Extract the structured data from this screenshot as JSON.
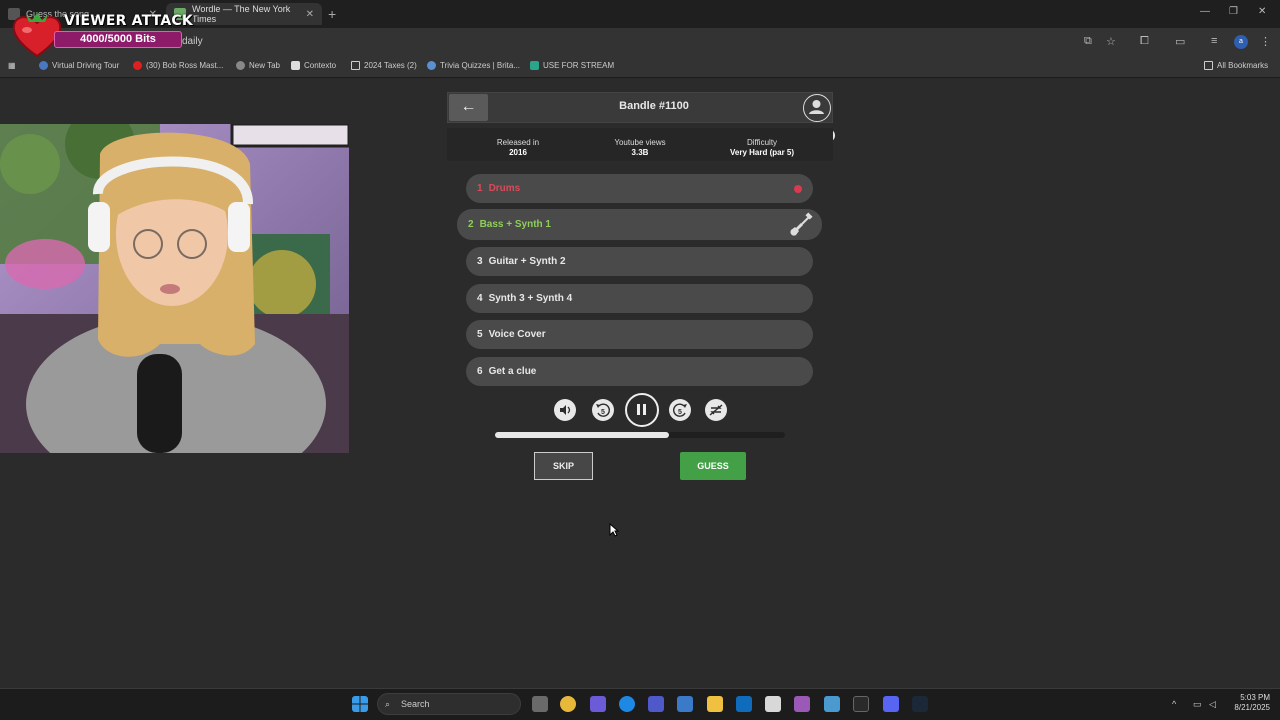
{
  "browser": {
    "tabs": [
      {
        "label": "Guess the song ..."
      },
      {
        "label": "Wordle — The New York Times"
      }
    ],
    "url": "daily",
    "bookmarks": [
      {
        "label": "Virtual Driving Tour"
      },
      {
        "label": "(30) Bob Ross Mast..."
      },
      {
        "label": "New Tab"
      },
      {
        "label": "Contexto"
      },
      {
        "label": "2024 Taxes (2)"
      },
      {
        "label": "Trivia Quizzes | Brita..."
      },
      {
        "label": "USE FOR STREAM"
      }
    ],
    "all_bookmarks": "All Bookmarks",
    "profile_initial": "a"
  },
  "overlay": {
    "title": "VIEWER ATTACK",
    "bits": "4000/5000 Bits",
    "bits_progress": 0.8
  },
  "game": {
    "title": "Bandle #1100",
    "stats": [
      {
        "label": "Released in",
        "value": "2016"
      },
      {
        "label": "Youtube views",
        "value": "3.3B"
      },
      {
        "label": "Difficulty",
        "value": "Very Hard (par 5)"
      }
    ],
    "stems": [
      {
        "num": "1",
        "label": "Drums"
      },
      {
        "num": "2",
        "label": "Bass + Synth 1"
      },
      {
        "num": "3",
        "label": "Guitar + Synth 2"
      },
      {
        "num": "4",
        "label": "Synth 3 + Synth 4"
      },
      {
        "num": "5",
        "label": "Voice Cover"
      },
      {
        "num": "6",
        "label": "Get a clue"
      }
    ],
    "controls": {
      "rewind_seconds": "5",
      "forward_seconds": "5"
    },
    "playback_progress": 0.6,
    "skip_label": "SKIP",
    "guess_label": "GUESS"
  },
  "taskbar": {
    "search_placeholder": "Search",
    "time": "5:03 PM",
    "date": "8/21/2025"
  },
  "colors": {
    "accent_green": "#43a047",
    "drums_red": "#d84a5a",
    "active_stem_green": "#8fce5a"
  }
}
